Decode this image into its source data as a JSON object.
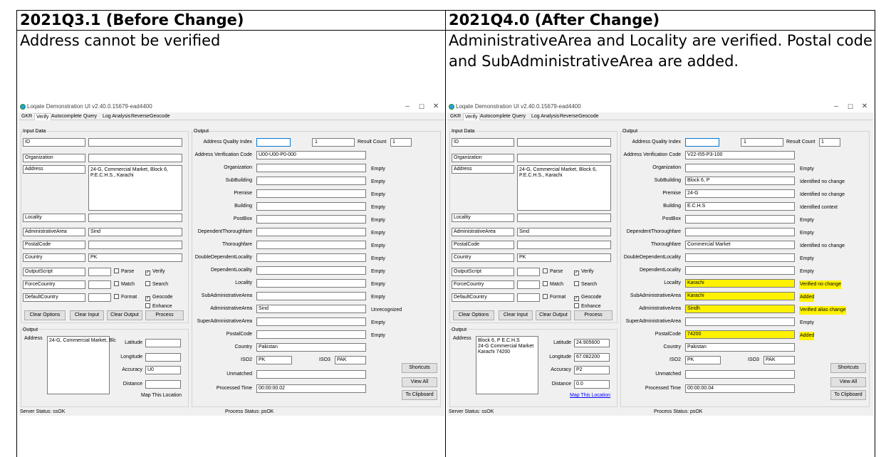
{
  "table": {
    "col1_header": "2021Q3.1 (Before Change)",
    "col2_header": "2021Q4.0 (After Change)",
    "col1_caption": "Address cannot be verified",
    "col2_caption": "AdministrativeArea and Locality are verified. Postal code and SubAdministrativeArea are added."
  },
  "window": {
    "title": "Loqate Demonstration UI v2.40.0.15679-ead4400",
    "minimize": "–",
    "maximize": "☐",
    "close": "✕",
    "tabs": [
      "GKR",
      "Verify",
      "Autocomplete",
      "Query",
      "Log Analysis",
      "ReverseGeocode"
    ],
    "active_tab": "Verify",
    "input_group_label": "Input Data",
    "output_group_label": "Output",
    "bottom_output_label": "Output",
    "input_rows": [
      "ID",
      "Organization",
      "Address",
      "Locality",
      "AdministrativeArea",
      "PostalCode",
      "Country"
    ],
    "option_rows": [
      "OutputScript",
      "ForceCountry",
      "DefaultCountry"
    ],
    "checkboxes": [
      "Parse",
      "Verify",
      "Match",
      "Search",
      "Format",
      "Geocode",
      "Enhance"
    ],
    "check_mark": "✓",
    "buttons": [
      "Clear Options",
      "Clear Input",
      "Clear Output",
      "Process"
    ],
    "address_label": "Address",
    "geo_labels": [
      "Latitude",
      "Longitude",
      "Accuracy",
      "Distance"
    ],
    "map_link": "Map This Location",
    "aqi_label": "Address Quality Index",
    "result_count_label": "Result Count",
    "avc_label": "Address Verification Code",
    "field_labels": [
      "Organization",
      "SubBuilding",
      "Premise",
      "Building",
      "PostBox",
      "DependentThoroughfare",
      "Thoroughfare",
      "DoubleDependentLocality",
      "DependentLocality",
      "Locality",
      "SubAdministrativeArea",
      "AdministrativeArea",
      "SuperAdministrativeArea",
      "PostalCode"
    ],
    "country_label": "Country",
    "iso2_label": "ISO2",
    "iso3_label": "ISO3",
    "unmatched_label": "Unmatched",
    "processed_time_label": "Processed Time",
    "side_buttons": [
      "Shortcuts",
      "View All",
      "To Clipboard"
    ],
    "server_status": "Server Status: ssOK",
    "process_status": "Process Status: psOK"
  },
  "before": {
    "address_input": [
      "24-G, Commercial Market, Block 6,",
      "P.E.C.H.S., Karachi"
    ],
    "admin_area_input": "Sind",
    "country_input": "PK",
    "output_address": [
      "24-G, Commercial Market, Blc"
    ],
    "accuracy": "U0",
    "latitude": "",
    "longitude": "",
    "distance": "",
    "aqi": "1",
    "result_count": "1",
    "avc": "U00-U00-P0-000",
    "field_values": [
      "",
      "",
      "",
      "",
      "",
      "",
      "",
      "",
      "",
      "",
      "",
      "Sind",
      "",
      ""
    ],
    "field_status": [
      "Empty",
      "Empty",
      "Empty",
      "Empty",
      "Empty",
      "Empty",
      "Empty",
      "Empty",
      "Empty",
      "Empty",
      "Empty",
      "Unrecognized",
      "Empty",
      "Empty"
    ],
    "country": "Pakistan",
    "iso2": "PK",
    "iso3": "PAK",
    "processed_time": "00:00:00.02"
  },
  "after": {
    "address_input": [
      "24-G, Commercial Market, Block 6,",
      "P.E.C.H.S., Karachi"
    ],
    "admin_area_input": "Sind",
    "country_input": "PK",
    "output_address": [
      "Block 6, P E.C.H.S",
      "24-G Commercial Market",
      "Karachi 74200"
    ],
    "accuracy": "P2",
    "latitude": "24.905600",
    "longitude": "67.082200",
    "distance": "0.0",
    "aqi": "1",
    "result_count": "1",
    "avc": "V22-I55-P3-100",
    "field_values": [
      "",
      "Block 6, P",
      "24-G",
      "E.C.H.S",
      "",
      "",
      "Commercial Market",
      "",
      "",
      "Karachi",
      "Karachi",
      "Sindh",
      "",
      "74200"
    ],
    "field_status": [
      "Empty",
      "Identified no change",
      "Identified no change",
      "Identified context",
      "Empty",
      "Empty",
      "Identified no change",
      "Empty",
      "Empty",
      "Verified no change",
      "Added",
      "Verified alias change",
      "Empty",
      "Added"
    ],
    "country": "Pakistan",
    "iso2": "PK",
    "iso3": "PAK",
    "processed_time": "00:00:00.04"
  },
  "colors": {
    "highlight": "#fff200",
    "link": "#0000ff"
  }
}
